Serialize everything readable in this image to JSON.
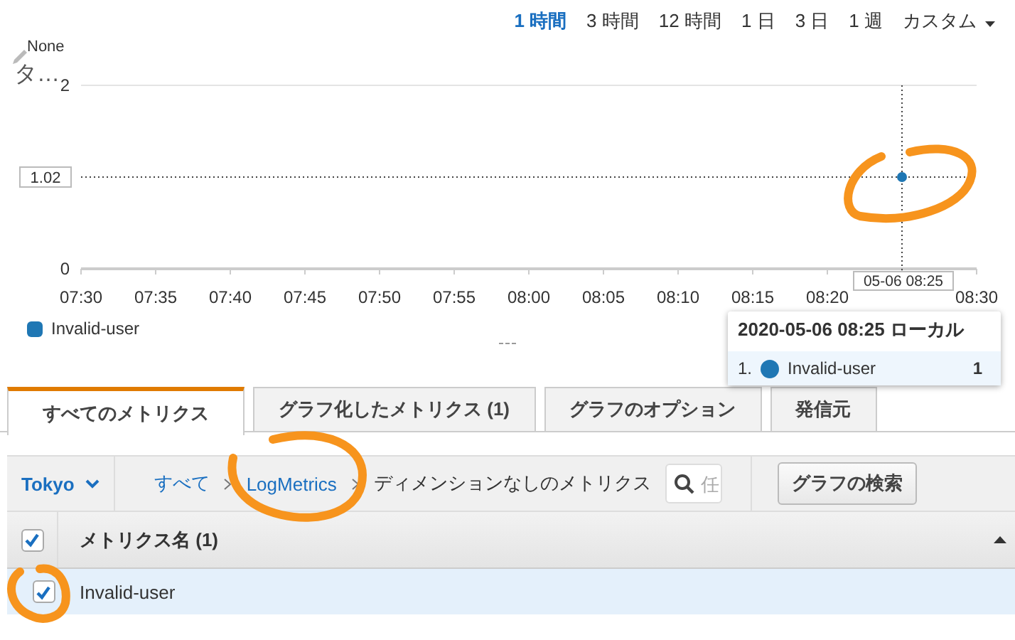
{
  "time_range": [
    {
      "label": "1 時間",
      "selected": true
    },
    {
      "label": "3 時間",
      "selected": false
    },
    {
      "label": "12 時間",
      "selected": false
    },
    {
      "label": "1 日",
      "selected": false
    },
    {
      "label": "3 日",
      "selected": false
    },
    {
      "label": "1 週",
      "selected": false
    },
    {
      "label": "カスタム",
      "selected": false,
      "kind": "dropdown"
    }
  ],
  "graph": {
    "unit_label": "None",
    "title": "タ…",
    "chart_data": {
      "type": "line",
      "ylim": [
        0,
        2
      ],
      "yticks": [
        0,
        2
      ],
      "categories": [
        "07:30",
        "07:35",
        "07:40",
        "07:45",
        "07:50",
        "07:55",
        "08:00",
        "08:05",
        "08:10",
        "08:15",
        "08:20",
        null,
        "08:30"
      ],
      "series": [
        {
          "name": "Invalid-user",
          "color": "#1f77b4",
          "marker": true,
          "values": [
            null,
            null,
            null,
            null,
            null,
            null,
            null,
            null,
            null,
            null,
            null,
            1,
            null
          ]
        }
      ]
    },
    "crosshair": {
      "y_label": "1.02",
      "x_label": "05-06 08:25"
    },
    "tooltip": {
      "title": "2020-05-06 08:25 ローカル",
      "rows": [
        {
          "index": "1.",
          "name": "Invalid-user",
          "color": "#1f77b4",
          "value": "1"
        }
      ]
    }
  },
  "tabs": [
    {
      "label": "すべてのメトリクス",
      "selected": true
    },
    {
      "label": "グラフ化したメトリクス (1)",
      "selected": false
    },
    {
      "label": "グラフのオプション",
      "selected": false
    },
    {
      "label": "発信元",
      "selected": false
    }
  ],
  "toolbar": {
    "region": "Tokyo",
    "breadcrumb": [
      {
        "label": "すべて",
        "link": true
      },
      {
        "label": "LogMetrics",
        "link": true
      },
      {
        "label": "ディメンションなしのメトリクス",
        "link": false
      }
    ],
    "search": {
      "placeholder": "任"
    },
    "button": "グラフの検索"
  },
  "table": {
    "header": {
      "label": "メトリクス名 (1)",
      "checked": true
    },
    "rows": [
      {
        "name": "Invalid-user",
        "checked": true,
        "selected": true
      }
    ]
  }
}
